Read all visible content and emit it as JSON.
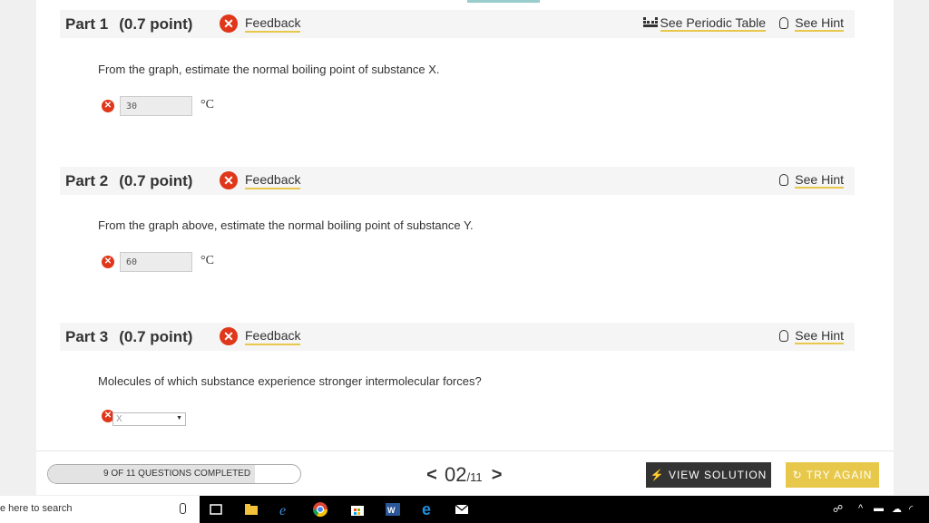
{
  "parts": [
    {
      "label": "Part 1",
      "points": "(0.7 point)",
      "feedback": "Feedback",
      "periodic_table": "See Periodic Table",
      "hint": "See Hint",
      "question": "From the graph, estimate the normal boiling point of substance X.",
      "answer": "30",
      "unit": "°C"
    },
    {
      "label": "Part 2",
      "points": "(0.7 point)",
      "feedback": "Feedback",
      "hint": "See Hint",
      "question": "From the graph above, estimate the normal boiling point of substance Y.",
      "answer": "60",
      "unit": "°C"
    },
    {
      "label": "Part 3",
      "points": "(0.7 point)",
      "feedback": "Feedback",
      "hint": "See Hint",
      "question": "Molecules of which substance experience stronger intermolecular forces?",
      "answer": "X"
    }
  ],
  "footer": {
    "progress_text": "9 OF 11 QUESTIONS COMPLETED",
    "progress_fraction": 0.82,
    "current_page": "02",
    "total_pages": "/11",
    "view_solution": "VIEW SOLUTION",
    "try_again": "TRY AGAIN"
  },
  "taskbar": {
    "search_placeholder": "e here to search"
  },
  "colors": {
    "error": "#e0361a",
    "accent": "#e8c84a",
    "dark_button": "#333333"
  }
}
